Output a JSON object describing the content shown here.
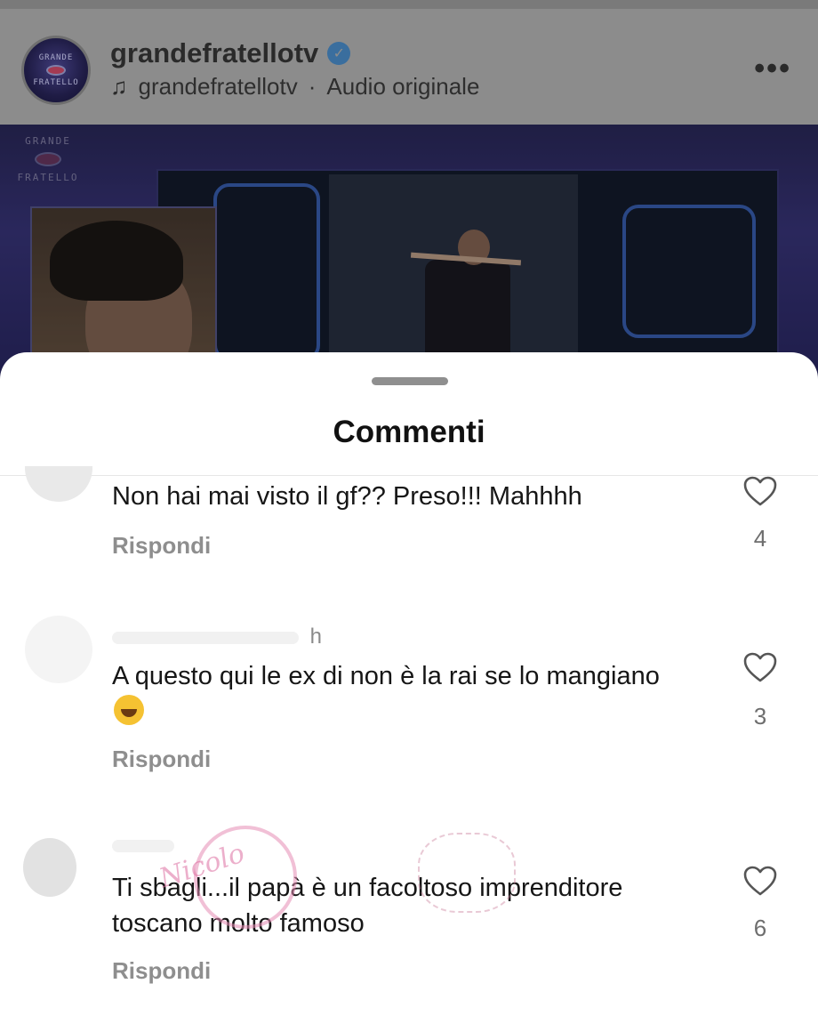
{
  "header": {
    "account_name": "grandefratellotv",
    "verified_icon": "verified-badge-icon",
    "audio_account": "grandefratellotv",
    "audio_separator": "·",
    "audio_label": "Audio originale",
    "avatar_line1": "GRANDE",
    "avatar_line2": "FRATELLO"
  },
  "video": {
    "logo_line1": "GRANDE",
    "logo_line2": "FRATELLO"
  },
  "sheet": {
    "title": "Commenti"
  },
  "comments": [
    {
      "text": "Non hai mai visto il gf?? Preso!!! Mahhhh",
      "reply_label": "Rispondi",
      "likes": "4",
      "meta": ""
    },
    {
      "text": "A questo qui le ex di non è la rai se lo mangiano",
      "reply_label": "Rispondi",
      "likes": "3",
      "meta": "h"
    },
    {
      "text": "Ti sbagli...il papà  è  un facoltoso imprenditore  toscano molto famoso",
      "reply_label": "Rispondi",
      "likes": "6",
      "meta": ""
    }
  ],
  "watermark": {
    "text": "Nicolo"
  },
  "colors": {
    "header_dim": "#8c8c8c",
    "verified": "#3a6e9e",
    "reply_gray": "#8e8e8e",
    "sheet_bg": "#ffffff"
  }
}
